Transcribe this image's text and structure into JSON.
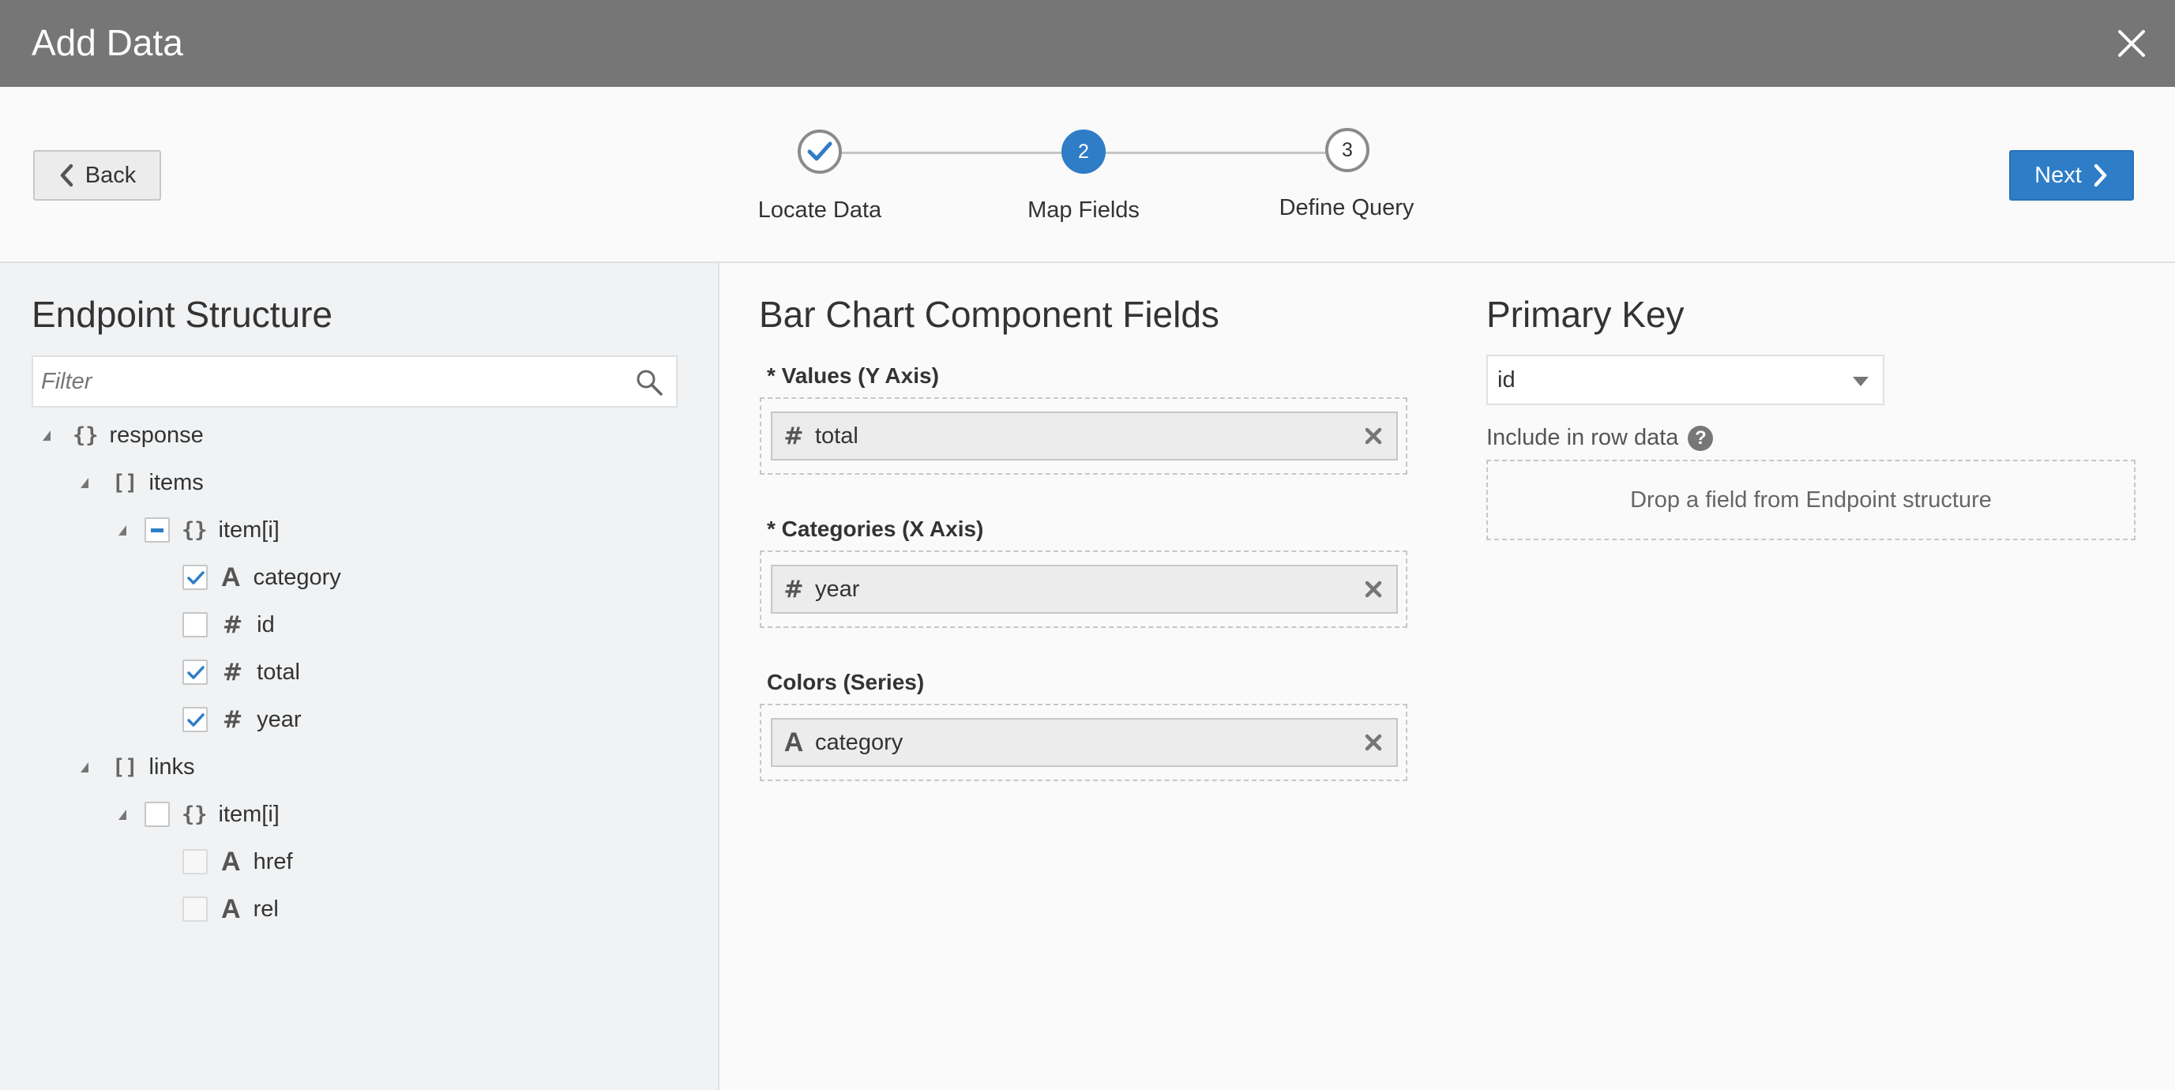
{
  "dialog": {
    "title": "Add Data",
    "close_icon": "close-icon"
  },
  "wizard": {
    "back_label": "Back",
    "next_label": "Next",
    "steps": [
      {
        "number": "1",
        "label": "Locate Data",
        "state": "completed"
      },
      {
        "number": "2",
        "label": "Map Fields",
        "state": "current"
      },
      {
        "number": "3",
        "label": "Define Query",
        "state": "future"
      }
    ]
  },
  "endpoint": {
    "heading": "Endpoint Structure",
    "filter_placeholder": "Filter",
    "tree": {
      "response": {
        "glyph": "{}",
        "label": "response"
      },
      "items": {
        "glyph": "[]",
        "label": "items"
      },
      "items_item": {
        "glyph": "{}",
        "label": "item[i]",
        "checkbox": "mixed"
      },
      "category": {
        "type": "A",
        "label": "category",
        "checked": true
      },
      "id": {
        "type": "#",
        "label": "id",
        "checked": false
      },
      "total": {
        "type": "#",
        "label": "total",
        "checked": true
      },
      "year": {
        "type": "#",
        "label": "year",
        "checked": true
      },
      "links": {
        "glyph": "[]",
        "label": "links"
      },
      "links_item": {
        "glyph": "{}",
        "label": "item[i]",
        "checkbox": "unchecked"
      },
      "href": {
        "type": "A",
        "label": "href",
        "checked": false
      },
      "rel": {
        "type": "A",
        "label": "rel",
        "checked": false
      }
    }
  },
  "component_fields": {
    "heading": "Bar Chart Component Fields",
    "values": {
      "label": "* Values (Y Axis)",
      "chip_type": "#",
      "chip": "total"
    },
    "categories": {
      "label": "* Categories (X Axis)",
      "chip_type": "#",
      "chip": "year"
    },
    "colors": {
      "label": "Colors (Series)",
      "chip_type": "A",
      "chip": "category"
    }
  },
  "primary_key": {
    "heading": "Primary Key",
    "selected": "id",
    "include_label": "Include in row data",
    "help_glyph": "?",
    "drop_hint": "Drop a field from Endpoint structure"
  },
  "colors": {
    "titlebar": "#767676",
    "accent": "#2e7dc6",
    "left_panel": "#f1f2f3"
  }
}
